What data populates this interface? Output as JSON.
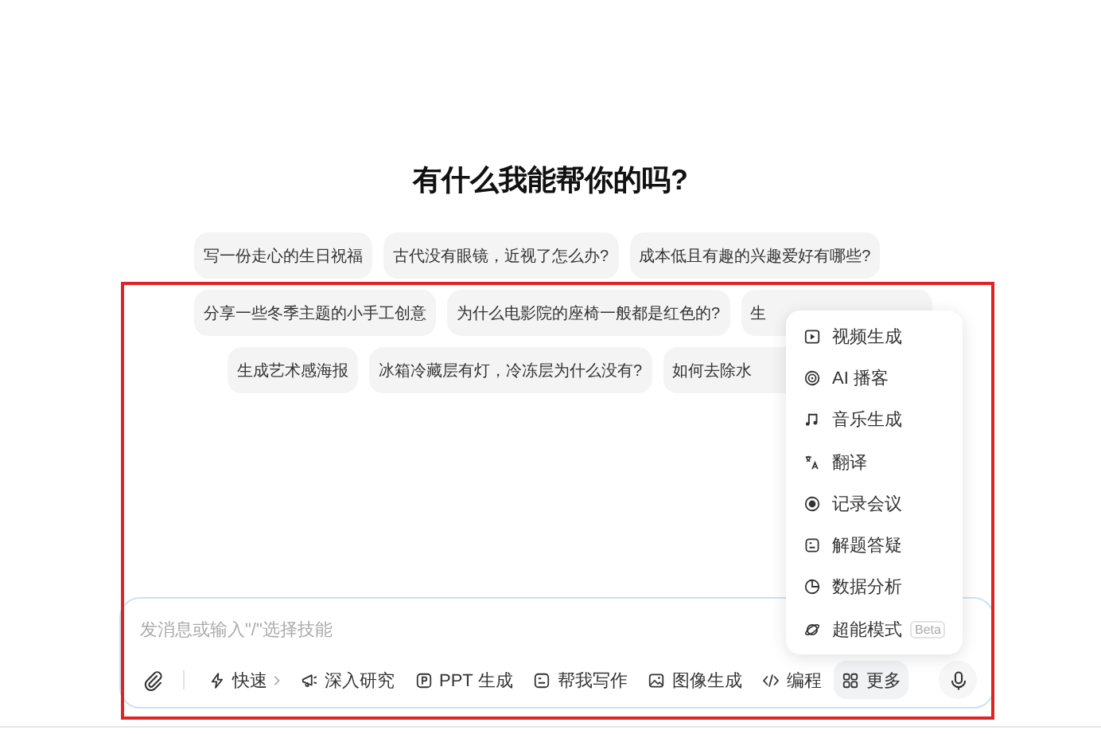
{
  "title": "有什么我能帮你的吗?",
  "suggestion_rows": [
    [
      "写一份走心的生日祝福",
      "古代没有眼镜，近视了怎么办?",
      "成本低且有趣的兴趣爱好有哪些?"
    ],
    [
      "分享一些冬季主题的小手工创意",
      "为什么电影院的座椅一般都是红色的?",
      "生"
    ],
    [
      "生成艺术感海报",
      "冰箱冷藏层有灯，冷冻层为什么没有?",
      "如何去除水"
    ]
  ],
  "menu": [
    {
      "kind": "video",
      "label": "视频生成"
    },
    {
      "kind": "podcast",
      "label": "AI 播客"
    },
    {
      "kind": "music",
      "label": "音乐生成"
    },
    {
      "kind": "translate",
      "label": "翻译"
    },
    {
      "kind": "record",
      "label": "记录会议"
    },
    {
      "kind": "solve",
      "label": "解题答疑"
    },
    {
      "kind": "chart",
      "label": "数据分析"
    },
    {
      "kind": "planet",
      "label": "超能模式",
      "badge": "Beta"
    }
  ],
  "input": {
    "placeholder": "发消息或输入\"/\"选择技能"
  },
  "tools": [
    {
      "kind": "fast",
      "label": "快速",
      "selected": false
    },
    {
      "kind": "research",
      "label": "深入研究",
      "selected": false
    },
    {
      "kind": "ppt",
      "label": "PPT 生成",
      "selected": false
    },
    {
      "kind": "write",
      "label": "帮我写作",
      "selected": false
    },
    {
      "kind": "image",
      "label": "图像生成",
      "selected": false
    },
    {
      "kind": "code",
      "label": "编程",
      "selected": false
    },
    {
      "kind": "more",
      "label": "更多",
      "selected": true
    }
  ]
}
